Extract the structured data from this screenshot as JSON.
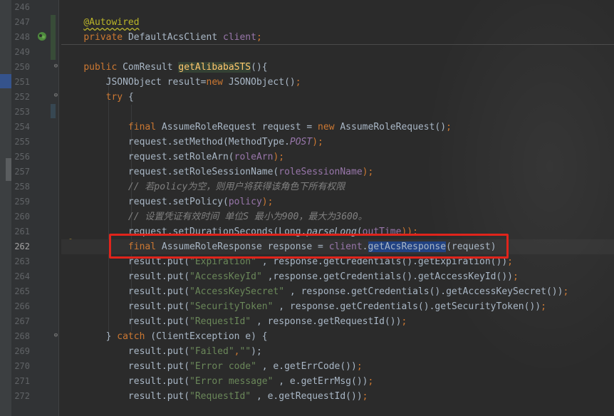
{
  "gutter": {
    "line_numbers": [
      "246",
      "247",
      "248",
      "249",
      "250",
      "251",
      "252",
      "253",
      "254",
      "255",
      "256",
      "257",
      "258",
      "259",
      "260",
      "261",
      "262",
      "263",
      "264",
      "265",
      "266",
      "267",
      "268",
      "269",
      "270",
      "271",
      "272"
    ],
    "current_line": "262",
    "icons": [
      "bean-icon",
      "lightbulb-icon"
    ]
  },
  "code": {
    "l247": {
      "text": "@Autowired"
    },
    "l248": {
      "kw": "private ",
      "type": "DefaultAcsClient ",
      "field": "client",
      "end": ";"
    },
    "l250": {
      "kw": "public ",
      "type": "ComResult ",
      "method": "getAlibabaSTS",
      "end": "(){"
    },
    "l251": {
      "a": "    JSONObject result=",
      "kw": "new ",
      "b": "JSONObject()",
      "end": ";"
    },
    "l252": {
      "kw": "    try ",
      "b": "{"
    },
    "l254": {
      "kw1": "        final ",
      "a": "AssumeRoleRequest request = ",
      "kw2": "new ",
      "b": "AssumeRoleRequest()",
      "end": ";"
    },
    "l255": {
      "a": "        request.setMethod(MethodType.",
      "field": "POST",
      "end": ");"
    },
    "l256": {
      "a": "        request.setRoleArn(",
      "field": "roleArn",
      "end": ");"
    },
    "l257": {
      "a": "        request.setRoleSessionName(",
      "field": "roleSessionName",
      "end": ");"
    },
    "l258": {
      "text": "        // 若policy为空，则用户将获得该角色下所有权限"
    },
    "l259": {
      "a": "        request.setPolicy(",
      "field": "policy",
      "end": ");"
    },
    "l260": {
      "text": "        // 设置凭证有效时间 单位S 最小为900，最大为3600。"
    },
    "l261": {
      "a": "        request.setDurationSeconds(Long.",
      "m": "parseLong",
      "b": "(",
      "field": "outTime",
      "end": "));"
    },
    "l262": {
      "kw": "        final ",
      "a": "AssumeRoleResponse response = ",
      "field": "client",
      "b": ".",
      "sel": "getAcsResponse",
      "end": "(request)"
    },
    "l263": {
      "a": "        result.put(",
      "str": "\"Expiration\" ",
      "b": ", response.getCredentials().getExpiration())",
      "end": ";"
    },
    "l264": {
      "a": "        result.put(",
      "str": "\"AccessKeyId\" ",
      "b": ",response.getCredentials().getAccessKeyId())",
      "end": ";"
    },
    "l265": {
      "a": "        result.put(",
      "str": "\"AccessKeySecret\" ",
      "b": ", response.getCredentials().getAccessKeySecret())",
      "end": ";"
    },
    "l266": {
      "a": "        result.put(",
      "str": "\"SecurityToken\" ",
      "b": ", response.getCredentials().getSecurityToken())",
      "end": ";"
    },
    "l267": {
      "a": "        result.put(",
      "str": "\"RequestId\" ",
      "b": ", response.getRequestId())",
      "end": ";"
    },
    "l268": {
      "a": "    } ",
      "kw": "catch ",
      "b": "(ClientException e) {"
    },
    "l269": {
      "a": "        result.put(",
      "str1": "\"Failed\"",
      "c": ",",
      "str2": "\"\"",
      "end": ");"
    },
    "l270": {
      "a": "        result.put(",
      "str": "\"Error code\" ",
      "b": ", e.getErrCode())",
      "end": ";"
    },
    "l271": {
      "a": "        result.put(",
      "str": "\"Error message\" ",
      "b": ", e.getErrMsg())",
      "end": ";"
    },
    "l272": {
      "a": "        result.put(",
      "str": "\"RequestId\" ",
      "b": ", e.getRequestId())",
      "end": ";"
    }
  },
  "colors": {
    "background": "#2b2b2b",
    "keyword": "#cc7832",
    "string": "#6a8759",
    "field": "#9876aa",
    "method": "#ffc66d",
    "annotation": "#bbb529",
    "comment": "#808080",
    "highlight_box": "#e0241b"
  }
}
